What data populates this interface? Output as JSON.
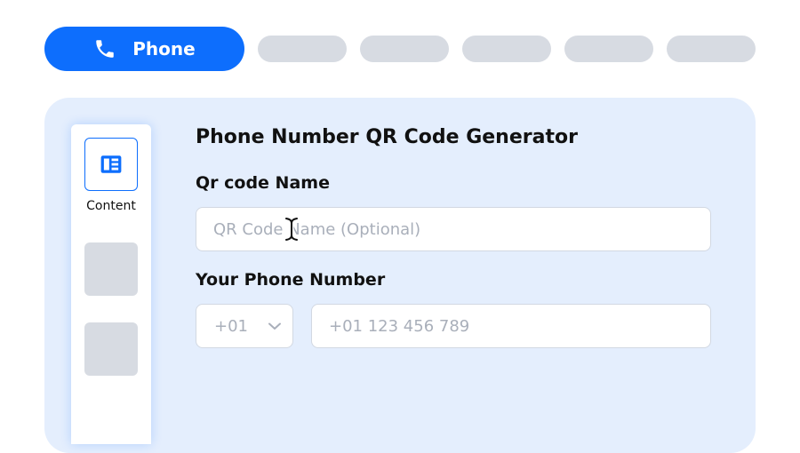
{
  "tabs": {
    "active": {
      "label": "Phone",
      "icon": "phone-icon"
    },
    "placeholders": 5
  },
  "sidebar": {
    "items": [
      {
        "label": "Content",
        "icon": "content-layout-icon",
        "active": true
      }
    ]
  },
  "form": {
    "title": "Phone Number QR Code Generator",
    "name_label": "Qr code Name",
    "name_placeholder": "QR Code Name (Optional)",
    "phone_label": "Your Phone Number",
    "country_code": "+01",
    "phone_placeholder": "+01 123 456 789"
  },
  "colors": {
    "accent": "#0d6efd",
    "panel_bg": "#e4eefd",
    "placeholder_block": "#d7dbe2"
  }
}
